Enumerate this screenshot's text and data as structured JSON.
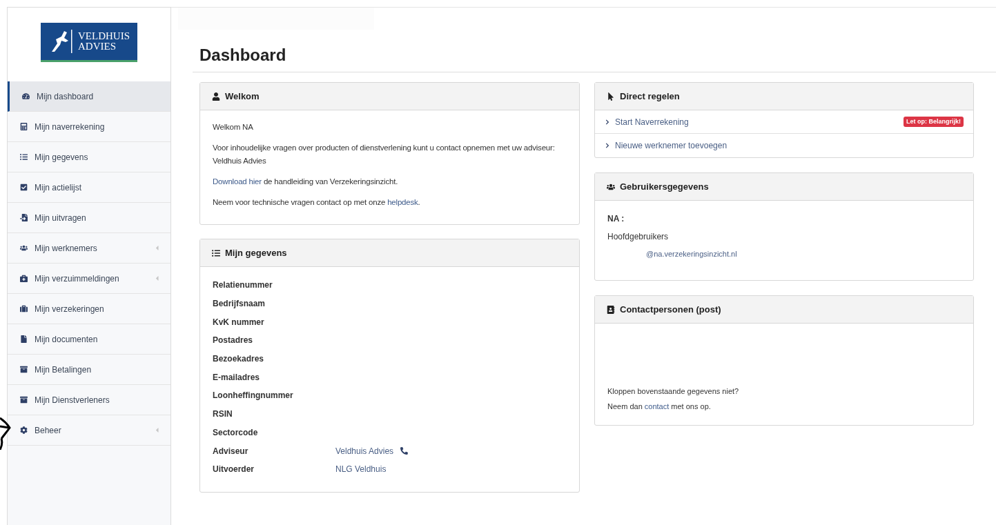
{
  "logo": {
    "lines": [
      "VELDHUIS",
      "ADVIES"
    ]
  },
  "sidebar": {
    "items": [
      {
        "label": "Mijn dashboard",
        "selected": true,
        "expandable": false
      },
      {
        "label": "Mijn naverrekening",
        "selected": false,
        "expandable": false
      },
      {
        "label": "Mijn gegevens",
        "selected": false,
        "expandable": false
      },
      {
        "label": "Mijn actielijst",
        "selected": false,
        "expandable": false
      },
      {
        "label": "Mijn uitvragen",
        "selected": false,
        "expandable": false
      },
      {
        "label": "Mijn werknemers",
        "selected": false,
        "expandable": true
      },
      {
        "label": "Mijn verzuimmeldingen",
        "selected": false,
        "expandable": true
      },
      {
        "label": "Mijn verzekeringen",
        "selected": false,
        "expandable": false
      },
      {
        "label": "Mijn documenten",
        "selected": false,
        "expandable": false
      },
      {
        "label": "Mijn Betalingen",
        "selected": false,
        "expandable": false
      },
      {
        "label": "Mijn Dienstverleners",
        "selected": false,
        "expandable": false
      },
      {
        "label": "Beheer",
        "selected": false,
        "expandable": true
      }
    ]
  },
  "page_title": "Dashboard",
  "welkom": {
    "title": "Welkom",
    "paragraphs": [
      [
        {
          "kind": "text",
          "text": "Welkom NA"
        }
      ],
      [
        {
          "kind": "text",
          "text": "Voor inhoudelijke vragen over producten of dienstverlening kunt u contact opnemen met uw adviseur: Veldhuis Advies"
        }
      ],
      [
        {
          "kind": "link",
          "text": "Download hier"
        },
        {
          "kind": "text",
          "text": " de handleiding van Verzekeringsinzicht."
        }
      ],
      [
        {
          "kind": "text",
          "text": "Neem voor technische vragen contact op met onze "
        },
        {
          "kind": "link",
          "text": "helpdesk"
        },
        {
          "kind": "text",
          "text": "."
        }
      ]
    ]
  },
  "mijn_gegevens": {
    "title": "Mijn gegevens",
    "rows": [
      {
        "label": "Relatienummer"
      },
      {
        "label": "Bedrijfsnaam"
      },
      {
        "label": "KvK nummer"
      },
      {
        "label": "Postadres"
      },
      {
        "label": "Bezoekadres"
      },
      {
        "label": "E-mailadres"
      },
      {
        "label": "Loonheffingnummer"
      },
      {
        "label": "RSIN"
      },
      {
        "label": "Sectorcode"
      },
      {
        "label": "Adviseur",
        "value": "Veldhuis Advies",
        "phone": true
      },
      {
        "label": "Uitvoerder",
        "value": "NLG Veldhuis"
      }
    ]
  },
  "direct_regelen": {
    "title": "Direct regelen",
    "links": [
      {
        "label": "Start Naverrekening",
        "badge": "Let op: Belangrijk!"
      },
      {
        "label": "Nieuwe werknemer toevoegen"
      }
    ]
  },
  "gebruikersgegevens": {
    "title": "Gebruikersgegevens",
    "name": "NA :",
    "role": "Hoofdgebruikers",
    "email": "@na.verzekeringsinzicht.nl"
  },
  "contactpersonen": {
    "title": "Contactpersonen (post)",
    "paragraphs": [
      [
        {
          "kind": "text",
          "text": "Kloppen bovenstaande gegevens niet?"
        }
      ],
      [
        {
          "kind": "text",
          "text": "Neem dan "
        },
        {
          "kind": "link",
          "text": "contact"
        },
        {
          "kind": "text",
          "text": " met ons op."
        }
      ]
    ]
  }
}
